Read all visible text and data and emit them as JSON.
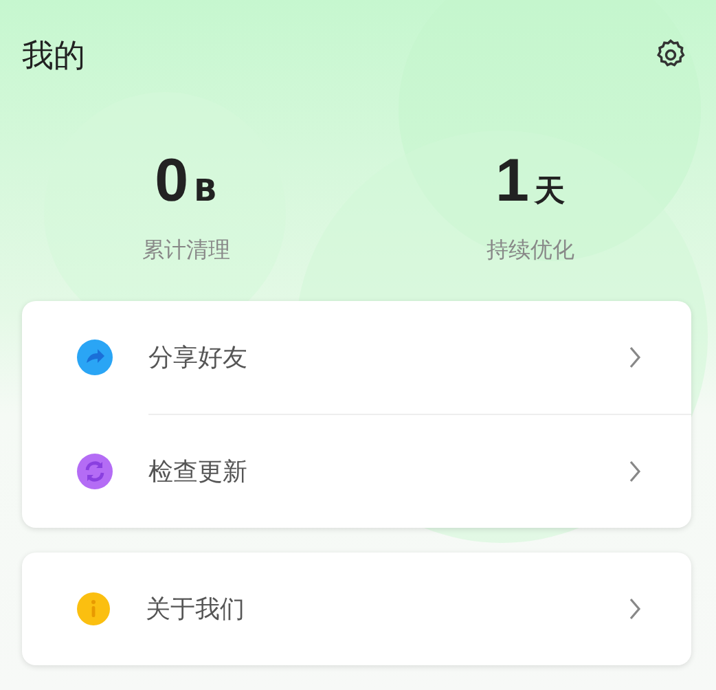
{
  "title": "我的",
  "stats": [
    {
      "value": "0",
      "unit": "B",
      "label": "累计清理"
    },
    {
      "value": "1",
      "unit": "天",
      "label": "持续优化"
    }
  ],
  "groups": [
    [
      {
        "kind": "share",
        "label": "分享好友"
      },
      {
        "kind": "update",
        "label": "检查更新"
      }
    ],
    [
      {
        "kind": "about",
        "label": "关于我们"
      }
    ]
  ]
}
